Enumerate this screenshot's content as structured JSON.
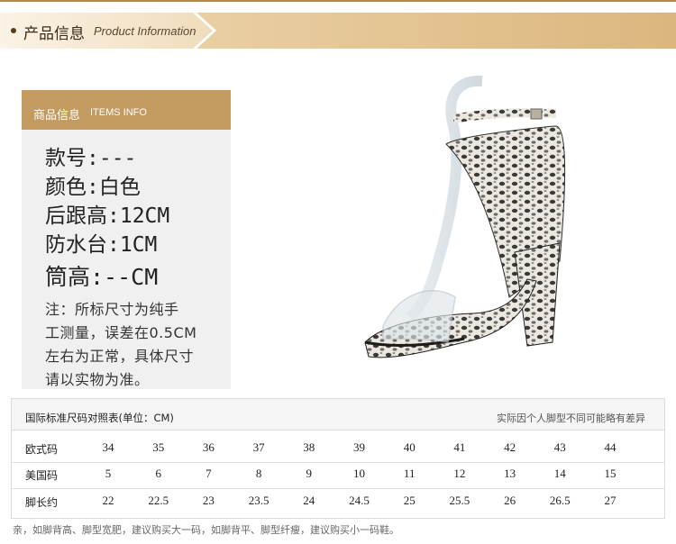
{
  "banner": {
    "title_cn": "产品信息",
    "title_en": "Product Information"
  },
  "info": {
    "header_cn": "商品信息",
    "header_en": "ITEMS INFO",
    "specs": [
      "款号:---",
      "颜色:白色",
      "后跟高:12CM",
      "防水台:1CM",
      "筒高:--CM"
    ],
    "note_lines": [
      "注：所标尺寸为纯手",
      "工测量，误差在0.5CM",
      "左右为正常，具体尺寸",
      "请以实物为准。"
    ]
  },
  "size_table": {
    "title": "国际标准尺码对照表(单位：CM)",
    "hint": "实际因个人脚型不同可能略有差异",
    "rows": [
      {
        "label": "欧式码",
        "values": [
          "34",
          "35",
          "36",
          "37",
          "38",
          "39",
          "40",
          "41",
          "42",
          "43",
          "44"
        ]
      },
      {
        "label": "美国码",
        "values": [
          "5",
          "6",
          "7",
          "8",
          "9",
          "10",
          "11",
          "12",
          "13",
          "14",
          "15"
        ]
      },
      {
        "label": "脚长约",
        "values": [
          "22",
          "22.5",
          "23",
          "23.5",
          "24",
          "24.5",
          "25",
          "25.5",
          "26",
          "26.5",
          "27"
        ]
      }
    ]
  },
  "footnote": "亲，如脚背高、脚型宽肥，建议购买大一码，如脚背平、脚型纤瘦，建议购买小一码鞋。",
  "colors": {
    "accent": "#c39a60",
    "banner": "#dcb67e"
  },
  "icons": {
    "shoe": "snakeskin-block-heel-sandal-image"
  }
}
